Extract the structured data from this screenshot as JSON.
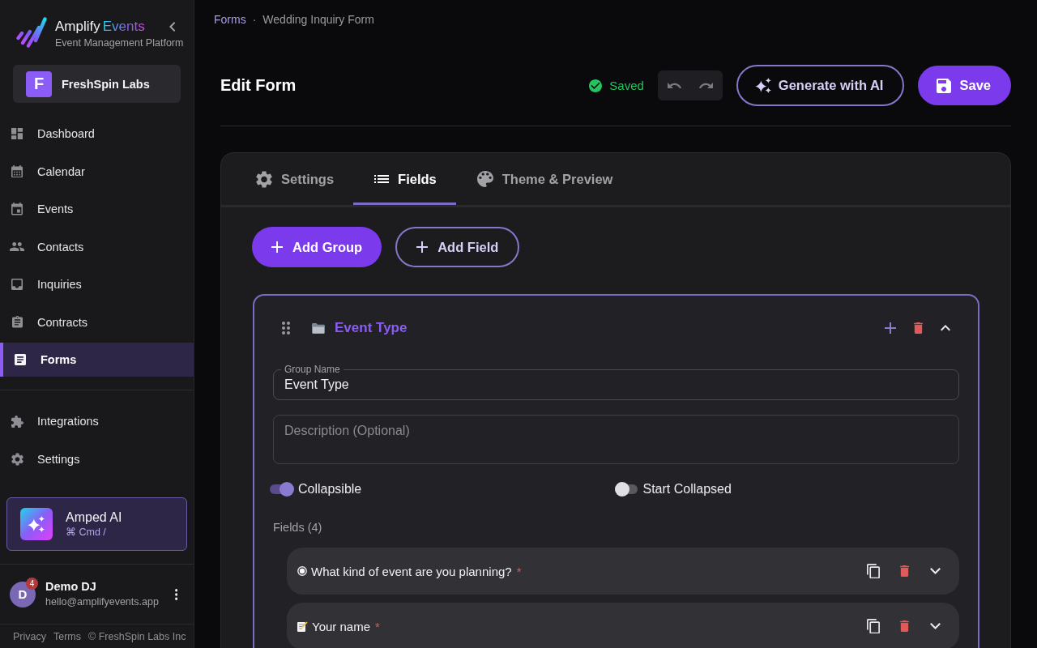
{
  "sidebar": {
    "brand": {
      "name": "Amplify",
      "accent": "Events",
      "tagline": "Event Management Platform"
    },
    "org": {
      "initial": "F",
      "name": "FreshSpin Labs"
    },
    "nav": [
      {
        "label": "Dashboard",
        "selected": false
      },
      {
        "label": "Calendar",
        "selected": false
      },
      {
        "label": "Events",
        "selected": false
      },
      {
        "label": "Contacts",
        "selected": false
      },
      {
        "label": "Inquiries",
        "selected": false
      },
      {
        "label": "Contracts",
        "selected": false
      },
      {
        "label": "Forms",
        "selected": true
      }
    ],
    "secondary_nav": [
      {
        "label": "Integrations",
        "selected": false
      },
      {
        "label": "Settings",
        "selected": false
      }
    ],
    "ai_assistant": {
      "title": "Amped AI",
      "shortcut": "⌘ Cmd /"
    },
    "user": {
      "initial": "D",
      "badge": "4",
      "name": "Demo DJ",
      "email": "hello@amplifyevents.app"
    },
    "footer_links": [
      "Privacy",
      "Terms",
      "© FreshSpin Labs Inc"
    ]
  },
  "breadcrumb": {
    "items": [
      {
        "label": "Forms",
        "current": false
      },
      {
        "label": "Wedding Inquiry Form",
        "current": true
      }
    ],
    "separator": "·"
  },
  "header": {
    "title": "Edit Form",
    "save_status": "Saved",
    "buttons": [
      {
        "label": "Generate with AI",
        "kind": "outline"
      },
      {
        "label": "Save",
        "kind": "primary"
      }
    ]
  },
  "editor": {
    "tabs": [
      {
        "label": "Settings",
        "selected": false
      },
      {
        "label": "Fields",
        "selected": true
      },
      {
        "label": "Theme & Preview",
        "selected": false
      }
    ],
    "actions": [
      {
        "label": "Add Group",
        "kind": "primary"
      },
      {
        "label": "Add Field",
        "kind": "outline"
      }
    ],
    "group": {
      "title": "Event Type",
      "expanded": true,
      "name_field": {
        "label": "Group Name",
        "value": "Event Type"
      },
      "description_field": {
        "placeholder": "Description (Optional)"
      },
      "toggles": [
        {
          "label": "Collapsible",
          "on": true
        },
        {
          "label": "Start Collapsed",
          "on": false
        }
      ],
      "fields_heading": "Fields (4)",
      "fields": [
        {
          "kind": "choice",
          "label": "What kind of event are you planning?",
          "required_mark": "*",
          "expanded": false
        },
        {
          "kind": "text",
          "label": "Your name",
          "required_mark": "*",
          "expanded": false
        }
      ]
    }
  }
}
